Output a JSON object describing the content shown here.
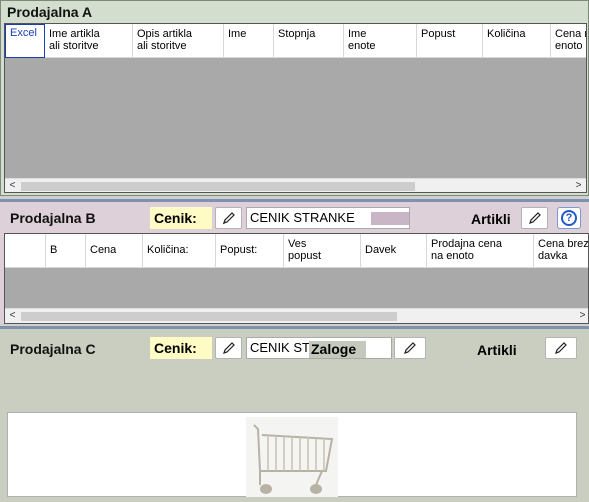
{
  "panel_a": {
    "title": "Prodajalna A",
    "columns": [
      "Excel",
      "Ime artikla\nali storitve",
      "Opis artikla\nali storitve",
      "Ime",
      "Stopnja",
      "Ime\nenote",
      "Popust",
      "Količina",
      "Cena na\nenoto"
    ]
  },
  "panel_b": {
    "title": "Prodajalna B",
    "cenik_label": "Cenik:",
    "cenik_value": "CENIK STRANKE",
    "artikli_label": "Artikli",
    "help_glyph": "?",
    "columns": [
      "",
      "B",
      "Cena",
      "Količina:",
      "Popust:",
      "Ves\npopust",
      "Davek",
      "Prodajna cena\nna enoto",
      "Cena brez\ndavka"
    ]
  },
  "panel_c": {
    "title": "Prodajalna C",
    "cenik_label": "Cenik:",
    "cenik_value": "CENIK ST",
    "zaloge_label": "Zaloge",
    "artikli_label": "Artikli"
  },
  "scroll": {
    "left": "<",
    "right": ">"
  },
  "icons": {
    "edit": "pencil-icon",
    "help": "help-icon",
    "cart": "shopping-cart-icon"
  },
  "colors": {
    "panel_a_bg": "#d3dece",
    "panel_b_bg": "#ddd0d8",
    "panel_c_bg": "#c9cec0",
    "cenik_highlight": "#fffbc4",
    "accent": "#2458c6"
  }
}
